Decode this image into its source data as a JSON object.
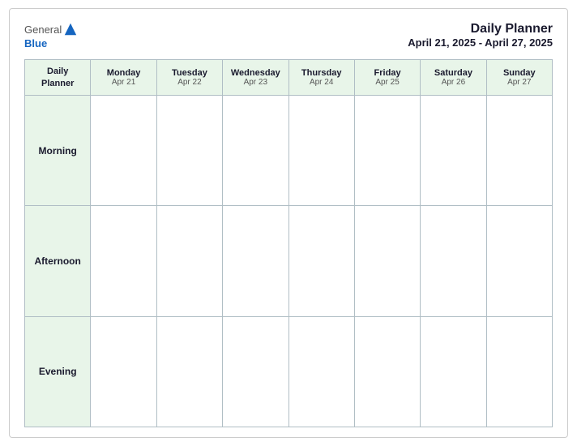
{
  "header": {
    "logo": {
      "general_text": "General",
      "blue_text": "Blue"
    },
    "title": "Daily Planner",
    "subtitle": "April 21, 2025 - April 27, 2025"
  },
  "table": {
    "header_col": {
      "line1": "Daily",
      "line2": "Planner"
    },
    "columns": [
      {
        "day": "Monday",
        "date": "Apr 21"
      },
      {
        "day": "Tuesday",
        "date": "Apr 22"
      },
      {
        "day": "Wednesday",
        "date": "Apr 23"
      },
      {
        "day": "Thursday",
        "date": "Apr 24"
      },
      {
        "day": "Friday",
        "date": "Apr 25"
      },
      {
        "day": "Saturday",
        "date": "Apr 26"
      },
      {
        "day": "Sunday",
        "date": "Apr 27"
      }
    ],
    "rows": [
      {
        "label": "Morning"
      },
      {
        "label": "Afternoon"
      },
      {
        "label": "Evening"
      }
    ]
  }
}
